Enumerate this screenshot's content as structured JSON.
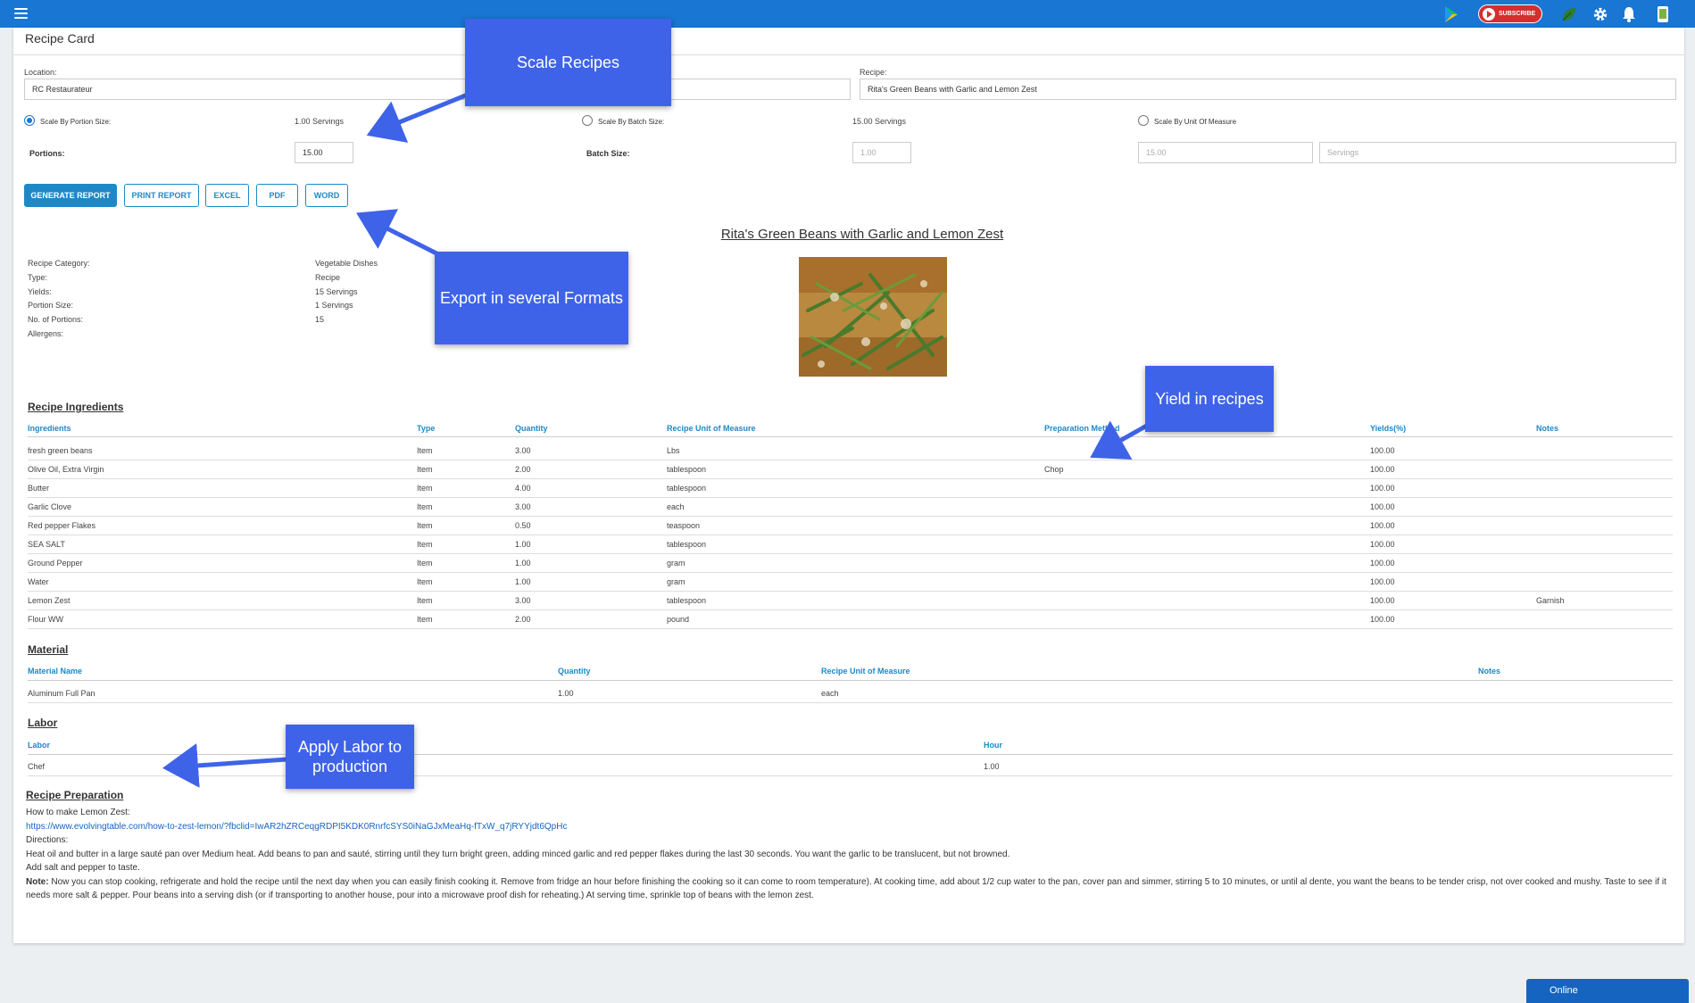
{
  "card": {
    "title": "Recipe Card"
  },
  "filters": {
    "location_label": "Location:",
    "location_value": "RC Restaurateur",
    "recipe_label": "Recipe:",
    "recipe_value": "Rita's Green Beans with Garlic and Lemon Zest"
  },
  "scaling": {
    "portion": {
      "label": "Scale By Portion Size:",
      "value": "1.00 Servings",
      "selected": true
    },
    "batch": {
      "label": "Scale By Batch Size:",
      "value": "15.00 Servings",
      "selected": false
    },
    "uom": {
      "label": "Scale By Unit Of Measure",
      "selected": false
    },
    "portions_label": "Portions:",
    "portions_value": "15.00",
    "batch_size_label": "Batch Size:",
    "batch_size_value": "1.00",
    "uom_quantity": "15.00",
    "uom_unit": "Servings"
  },
  "buttons": {
    "generate": "GENERATE REPORT",
    "print": "PRINT REPORT",
    "excel": "EXCEL",
    "pdf": "PDF",
    "word": "WORD"
  },
  "report": {
    "title": "Rita's Green Beans with Garlic and Lemon Zest",
    "info": [
      {
        "label": "Recipe Category:",
        "value": "Vegetable Dishes"
      },
      {
        "label": "Type:",
        "value": "Recipe"
      },
      {
        "label": "Yields:",
        "value": "15 Servings"
      },
      {
        "label": "Portion Size:",
        "value": "1 Servings"
      },
      {
        "label": "No. of Portions:",
        "value": "15"
      },
      {
        "label": "Allergens:",
        "value": ""
      }
    ]
  },
  "ingredients": {
    "title": "Recipe Ingredients",
    "headers": [
      "Ingredients",
      "Type",
      "Quantity",
      "Recipe Unit of Measure",
      "Preparation Method",
      "Yields(%)",
      "Notes"
    ],
    "rows": [
      [
        "fresh green beans",
        "Item",
        "3.00",
        "Lbs",
        "",
        "100.00",
        ""
      ],
      [
        "Olive Oil, Extra Virgin",
        "Item",
        "2.00",
        "tablespoon",
        "Chop",
        "100.00",
        ""
      ],
      [
        "Butter",
        "Item",
        "4.00",
        "tablespoon",
        "",
        "100.00",
        ""
      ],
      [
        "Garlic Clove",
        "Item",
        "3.00",
        "each",
        "",
        "100.00",
        ""
      ],
      [
        "Red pepper Flakes",
        "Item",
        "0.50",
        "teaspoon",
        "",
        "100.00",
        ""
      ],
      [
        "SEA SALT",
        "Item",
        "1.00",
        "tablespoon",
        "",
        "100.00",
        ""
      ],
      [
        "Ground Pepper",
        "Item",
        "1.00",
        "gram",
        "",
        "100.00",
        ""
      ],
      [
        "Water",
        "Item",
        "1.00",
        "gram",
        "",
        "100.00",
        ""
      ],
      [
        "Lemon Zest",
        "Item",
        "3.00",
        "tablespoon",
        "",
        "100.00",
        "Garnish"
      ],
      [
        "Flour WW",
        "Item",
        "2.00",
        "pound",
        "",
        "100.00",
        ""
      ]
    ]
  },
  "material": {
    "title": "Material",
    "headers": [
      "Material Name",
      "Quantity",
      "Recipe Unit of Measure",
      "Notes"
    ],
    "rows": [
      [
        "Aluminum Full Pan",
        "1.00",
        "each",
        ""
      ]
    ]
  },
  "labor": {
    "title": "Labor",
    "headers": [
      "Labor",
      "Hour"
    ],
    "rows": [
      [
        "Chef",
        "1.00"
      ]
    ]
  },
  "preparation": {
    "title": "Recipe Preparation",
    "line1": "How to make Lemon Zest:",
    "link": "https://www.evolvingtable.com/how-to-zest-lemon/?fbclid=IwAR2hZRCeqgRDPI5KDK0RnrfcSYS0iNaGJxMeaHq-fTxW_q7jRYYjdt6QpHc",
    "line2": "Directions:",
    "line3": "Heat oil and butter in a large sauté pan over Medium heat. Add beans to pan and sauté, stirring until they turn bright green, adding minced garlic and red pepper flakes during the last 30 seconds. You want the garlic to be translucent, but not browned.",
    "line4": "Add salt and pepper to taste.",
    "note_label": "Note:",
    "note_text": " Now you can stop cooking, refrigerate and hold the recipe until the next day when you can easily finish cooking it. Remove from fridge an hour before finishing the cooking so it can come to room temperature).  At cooking time, add about 1/2 cup water to the pan, cover pan and simmer, stirring 5 to 10 minutes, or until al dente, you want the beans to be tender crisp, not over cooked and mushy. Taste to see if it needs more salt & pepper. Pour beans into a serving dish (or if transporting to another house, pour into a  microwave proof dish for reheating.) At serving time, sprinkle top of beans with the lemon zest."
  },
  "callouts": {
    "scale": "Scale Recipes",
    "export": "Export in several Formats",
    "yield": "Yield in recipes",
    "labor": "Apply Labor to production"
  },
  "topbar": {
    "subscribe": "SUBSCRIBE"
  },
  "status": {
    "online": "Online"
  },
  "colors": {
    "topbar": "#1976d2",
    "accent": "#1e88c7",
    "callout": "#3f63e8"
  }
}
